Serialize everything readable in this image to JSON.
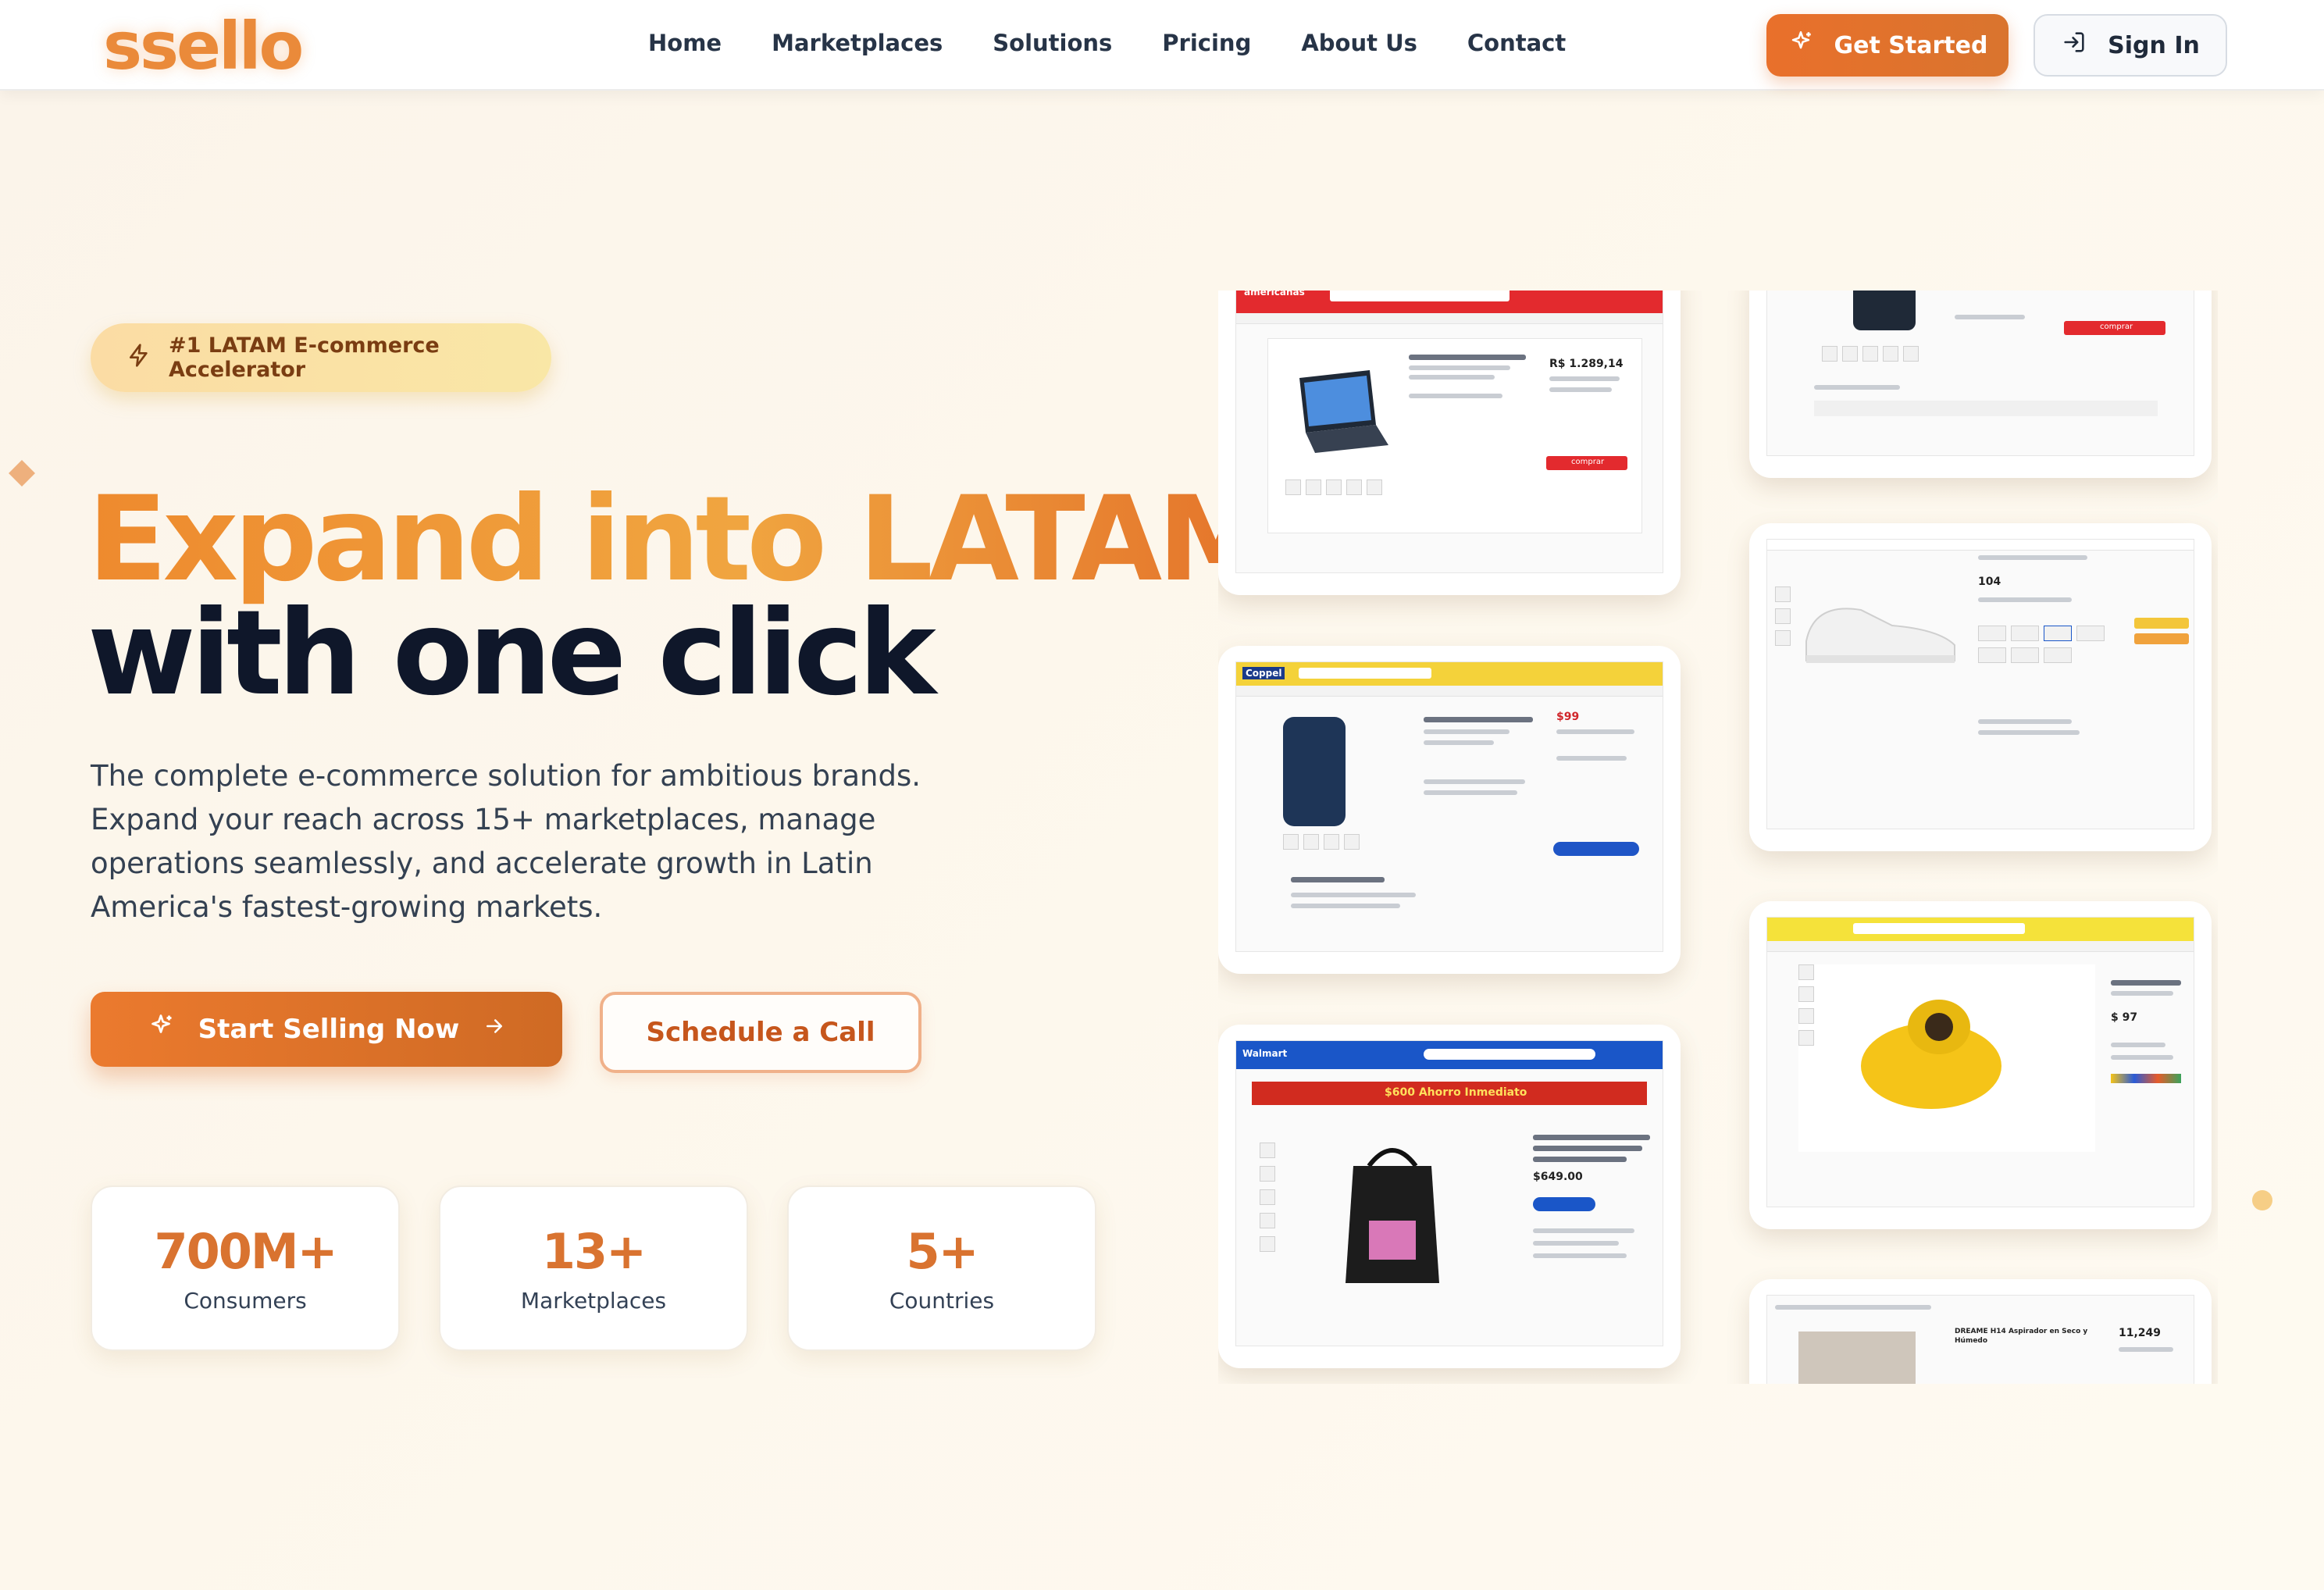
{
  "nav": {
    "logo": "ssello",
    "links": [
      "Home",
      "Marketplaces",
      "Solutions",
      "Pricing",
      "About Us",
      "Contact"
    ],
    "get_started": "Get Started",
    "sign_in": "Sign In"
  },
  "hero": {
    "badge": "#1 LATAM E-commerce Accelerator",
    "title_line1": "Expand into LATAM",
    "title_line2": "with one click",
    "subtitle": "The complete e-commerce solution for ambitious brands. Expand your reach across 15+ marketplaces, manage operations seamlessly, and accelerate growth in Latin America's fastest-growing markets.",
    "cta_primary": "Start Selling Now",
    "cta_secondary": "Schedule a Call"
  },
  "stats": [
    {
      "value": "700M+",
      "label": "Consumers"
    },
    {
      "value": "13+",
      "label": "Marketplaces"
    },
    {
      "value": "5+",
      "label": "Countries"
    }
  ],
  "marketplace_cards": {
    "americanas": {
      "brand": "americanas",
      "price": "R$ 1.289,14",
      "cta": "comprar",
      "accent": "#e32a2e"
    },
    "coppel": {
      "brand": "Coppel",
      "price": "$99",
      "accent": "#f4d23a"
    },
    "walmart": {
      "brand": "Walmart",
      "banner": "$600 Ahorro Inmediato",
      "price": "$649.00",
      "accent": "#1a56c8"
    },
    "phone_listing": {
      "cta": "comprar",
      "accent": "#e32a2e"
    },
    "sneaker_listing": {
      "price": "104",
      "accent": "#1a56c8"
    },
    "mercadolibre": {
      "price": "$ 97",
      "accent": "#f5e23a"
    },
    "dreame_listing": {
      "title": "DREAME H14 Aspirador en Seco y Húmedo",
      "price": "11,249"
    }
  },
  "colors": {
    "brand_orange": "#e9702b",
    "title_dark": "#0f172a"
  },
  "icons": {
    "get_started": "sparkle-icon",
    "sign_in": "login-icon",
    "badge": "lightning-icon",
    "start_selling": "sparkle-icon",
    "arrow": "arrow-right-icon"
  }
}
